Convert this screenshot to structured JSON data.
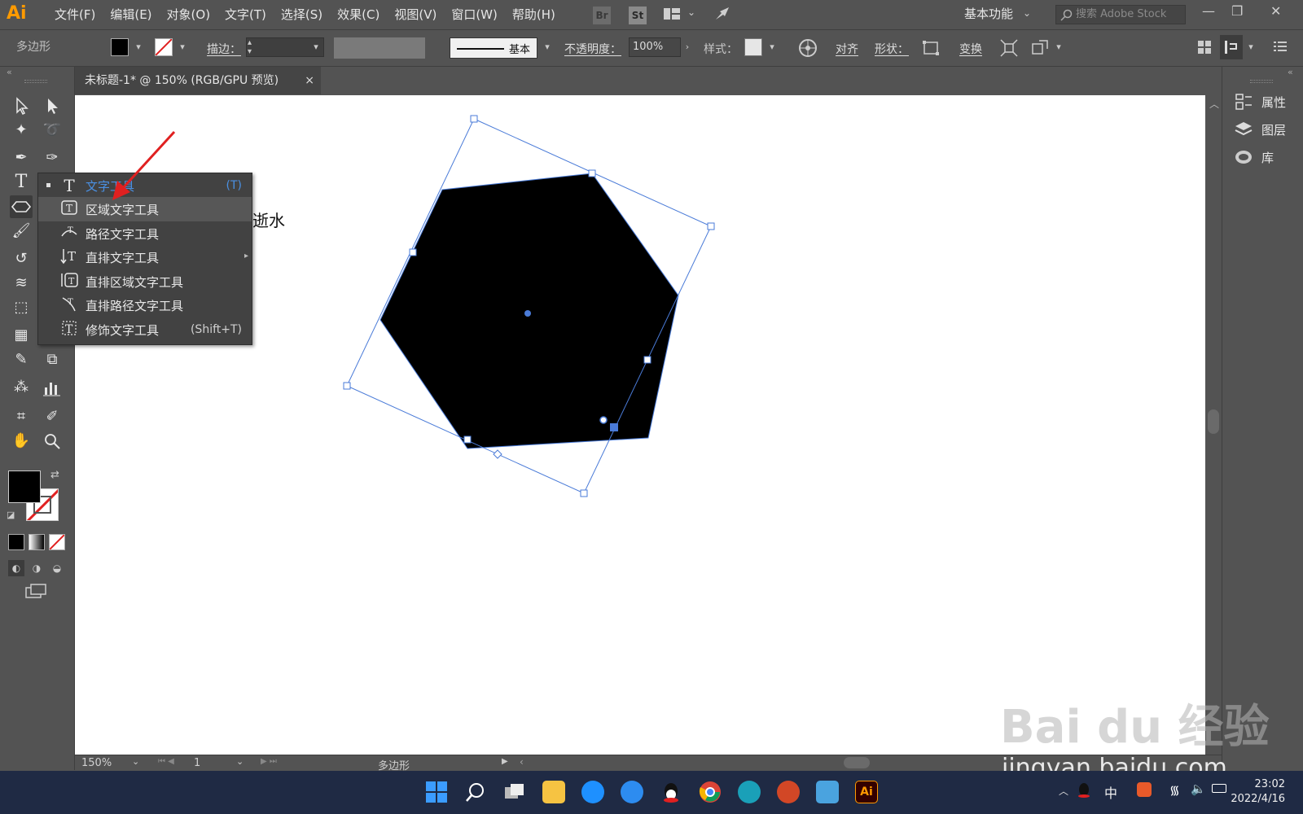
{
  "app": {
    "logo": "Ai",
    "menus": [
      "文件(F)",
      "编辑(E)",
      "对象(O)",
      "文字(T)",
      "选择(S)",
      "效果(C)",
      "视图(V)",
      "窗口(W)",
      "帮助(H)"
    ],
    "bridge_label": "Br",
    "stock_label": "St",
    "workspace": "基本功能",
    "search_placeholder": "搜索 Adobe Stock"
  },
  "control_bar": {
    "selection_label": "多边形",
    "stroke_label": "描边：",
    "stroke_style_label": "基本",
    "opacity_label": "不透明度：",
    "opacity_value": "100%",
    "style_label": "样式：",
    "align_label": "对齐",
    "shape_label": "形状：",
    "transform_label": "变换"
  },
  "document": {
    "tab_title": "未标题-1* @ 150% (RGB/GPU 预览)",
    "tab_close": "×",
    "partial_text": "逝水"
  },
  "flyout": {
    "items": [
      {
        "label": "文字工具",
        "shortcut": "(T)",
        "icon": "type-tool-icon",
        "current": true
      },
      {
        "label": "区域文字工具",
        "shortcut": "",
        "icon": "area-type-tool-icon",
        "hover": true
      },
      {
        "label": "路径文字工具",
        "shortcut": "",
        "icon": "type-on-path-tool-icon"
      },
      {
        "label": "直排文字工具",
        "shortcut": "",
        "icon": "vertical-type-tool-icon"
      },
      {
        "label": "直排区域文字工具",
        "shortcut": "",
        "icon": "vertical-area-type-tool-icon"
      },
      {
        "label": "直排路径文字工具",
        "shortcut": "",
        "icon": "vertical-type-on-path-tool-icon"
      },
      {
        "label": "修饰文字工具",
        "shortcut": "(Shift+T)",
        "icon": "touch-type-tool-icon"
      }
    ]
  },
  "right_panel": {
    "items": [
      {
        "label": "属性",
        "icon": "properties-icon"
      },
      {
        "label": "图层",
        "icon": "layers-icon"
      },
      {
        "label": "库",
        "icon": "libraries-icon"
      }
    ]
  },
  "status_bar": {
    "zoom": "150%",
    "artboard": "1",
    "tool_status": "多边形"
  },
  "taskbar": {
    "time": "23:02",
    "date": "2022/4/16",
    "input_lang": "中"
  },
  "watermark": {
    "brand": "Bai du 经验",
    "url": "jingyan.baidu.com"
  },
  "colors": {
    "ui_bg": "#535353",
    "canvas": "#ffffff",
    "selection": "#4a7bd8",
    "accent_text": "#4a90e2",
    "arrow": "#e02020",
    "taskbar": "#1f2a44"
  }
}
